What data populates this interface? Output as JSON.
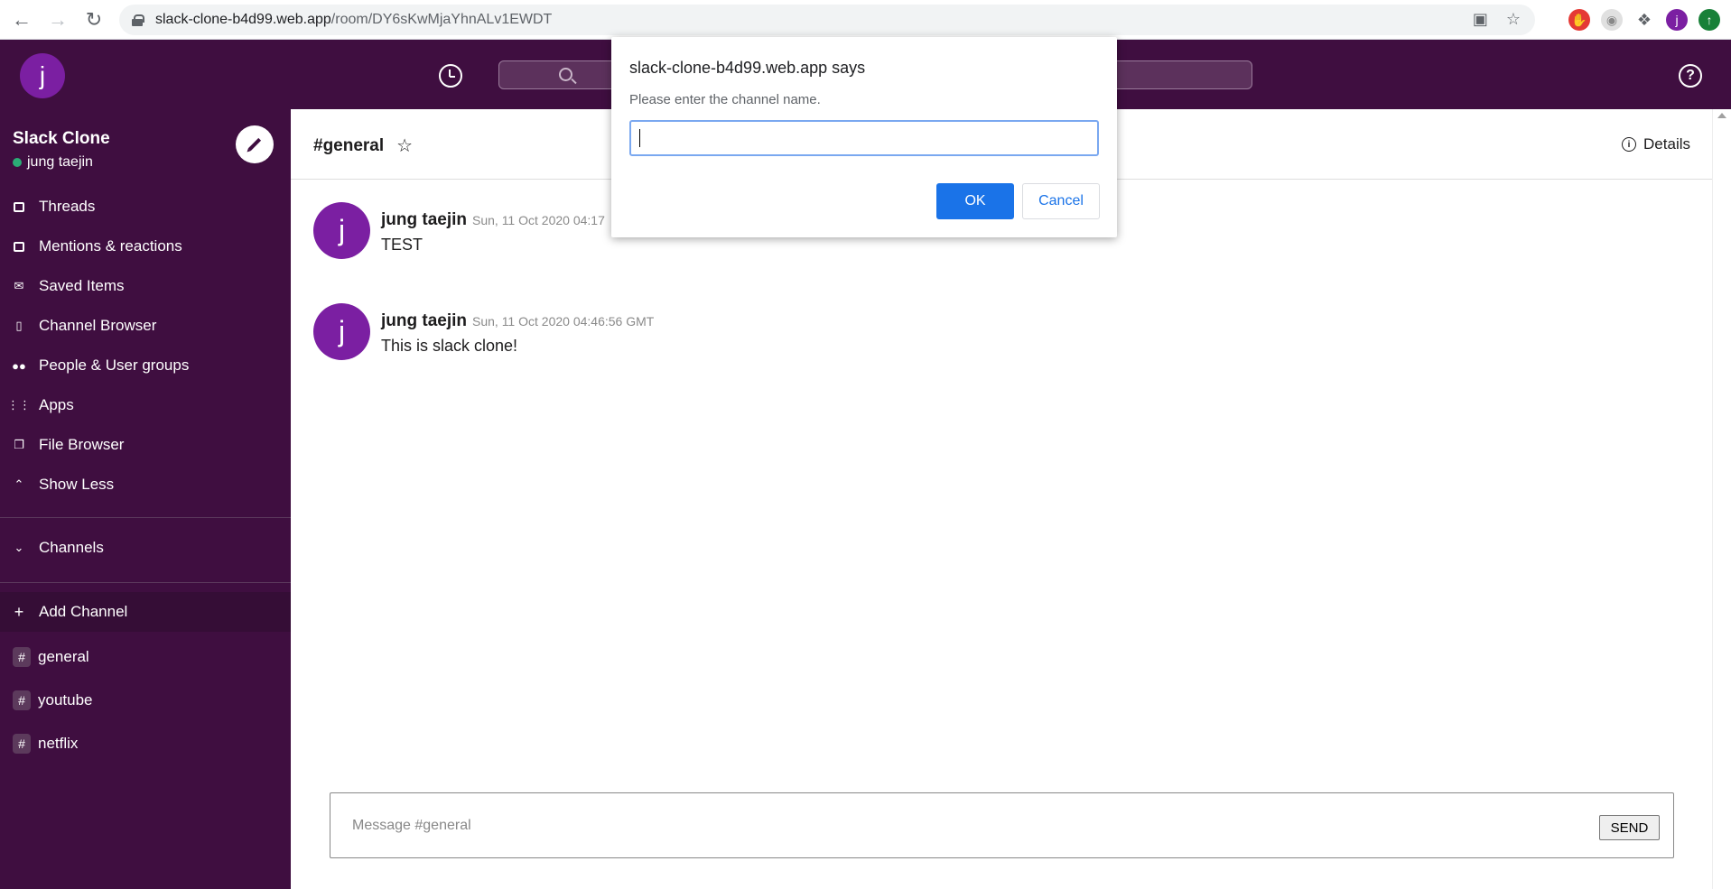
{
  "browser": {
    "url_host": "slack-clone-b4d99.web.app",
    "url_path": "/room/DY6sKwMjaYhnALv1EWDT",
    "profile_initial": "j"
  },
  "header": {
    "user_initial": "j"
  },
  "sidebar": {
    "workspace_name": "Slack Clone",
    "user_name": "jung taejin",
    "items": [
      {
        "label": "Threads",
        "icon": "threads-icon"
      },
      {
        "label": "Mentions & reactions",
        "icon": "inbox-icon"
      },
      {
        "label": "Saved Items",
        "icon": "drafts-icon"
      },
      {
        "label": "Channel Browser",
        "icon": "bookmark-icon"
      },
      {
        "label": "People & User groups",
        "icon": "people-icon"
      },
      {
        "label": "Apps",
        "icon": "apps-icon"
      },
      {
        "label": "File Browser",
        "icon": "file-copy-icon"
      },
      {
        "label": "Show Less",
        "icon": "expand-less-icon"
      }
    ],
    "channels_label": "Channels",
    "add_channel_label": "Add Channel",
    "channels": [
      {
        "name": "general"
      },
      {
        "name": "youtube"
      },
      {
        "name": "netflix"
      }
    ]
  },
  "channel": {
    "title": "#general",
    "details_label": "Details"
  },
  "messages": [
    {
      "initial": "j",
      "author": "jung taejin",
      "timestamp": "Sun, 11 Oct 2020 04:17",
      "text": "TEST"
    },
    {
      "initial": "j",
      "author": "jung taejin",
      "timestamp": "Sun, 11 Oct 2020 04:46:56 GMT",
      "text": "This is slack clone!"
    }
  ],
  "composer": {
    "placeholder": "Message #general",
    "send_label": "SEND"
  },
  "dialog": {
    "title": "slack-clone-b4d99.web.app says",
    "message": "Please enter the channel name.",
    "input_value": "",
    "ok_label": "OK",
    "cancel_label": "Cancel"
  },
  "colors": {
    "sidebar_bg": "#3f0e40",
    "avatar": "#7b1fa2",
    "dialog_ok": "#1a73e8",
    "online": "#2bac76"
  }
}
